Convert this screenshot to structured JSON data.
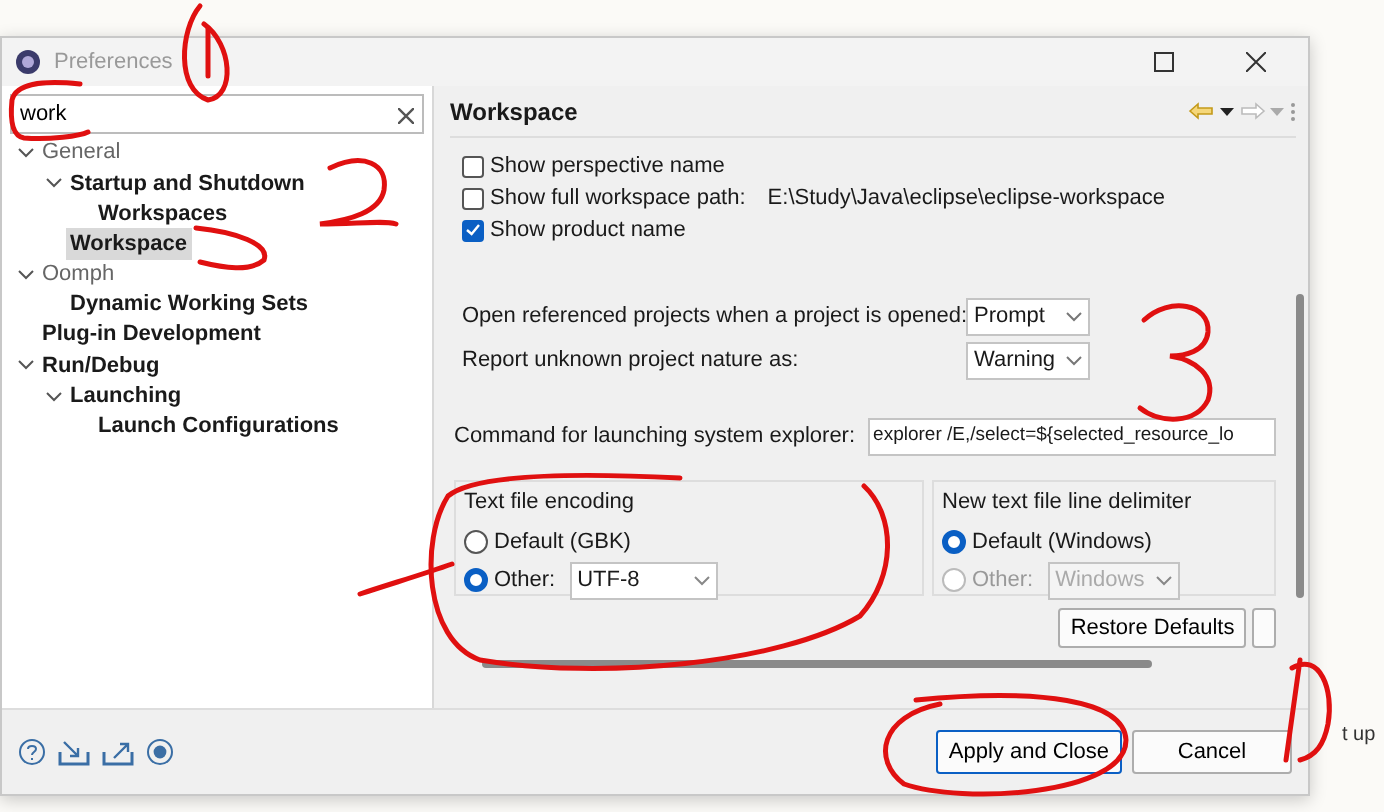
{
  "window": {
    "title": "Preferences"
  },
  "filter": {
    "value": "work"
  },
  "tree": [
    {
      "label": "General",
      "matched": false,
      "selected": false,
      "expanded": true,
      "children": [
        {
          "label": "Startup and Shutdown",
          "matched": true,
          "selected": false,
          "expanded": true,
          "children": [
            {
              "label": "Workspaces",
              "matched": true,
              "selected": false
            }
          ]
        },
        {
          "label": "Workspace",
          "matched": true,
          "selected": true
        }
      ]
    },
    {
      "label": "Oomph",
      "matched": false,
      "selected": false,
      "expanded": true,
      "children": [
        {
          "label": "Dynamic Working Sets",
          "matched": true,
          "selected": false
        }
      ]
    },
    {
      "label": "Plug-in Development",
      "matched": true,
      "selected": false
    },
    {
      "label": "Run/Debug",
      "matched": true,
      "selected": false,
      "expanded": true,
      "children": [
        {
          "label": "Launching",
          "matched": true,
          "selected": false,
          "expanded": true,
          "children": [
            {
              "label": "Launch Configurations",
              "matched": true,
              "selected": false
            }
          ]
        }
      ]
    }
  ],
  "page": {
    "title": "Workspace",
    "checkboxes": [
      {
        "label": "Show perspective name",
        "checked": false
      },
      {
        "label": "Show full workspace path:",
        "checked": false,
        "value": "E:\\Study\\Java\\eclipse\\eclipse-workspace"
      },
      {
        "label": "Show product name",
        "checked": true
      }
    ],
    "selects": [
      {
        "label": "Open referenced projects when a project is opened:",
        "value": "Prompt"
      },
      {
        "label": "Report unknown project nature as:",
        "value": "Warning"
      }
    ],
    "command": {
      "label": "Command for launching system explorer:",
      "value": "explorer /E,/select=${selected_resource_lo"
    },
    "groups": [
      {
        "title": "Text file encoding",
        "options": [
          {
            "label": "Default (GBK)",
            "selected": false
          },
          {
            "label": "Other:",
            "selected": true,
            "value": "UTF-8",
            "disabled": false
          }
        ]
      },
      {
        "title": "New text file line delimiter",
        "options": [
          {
            "label": "Default (Windows)",
            "selected": true
          },
          {
            "label": "Other:",
            "selected": false,
            "value": "Windows",
            "disabled": true
          }
        ]
      }
    ],
    "buttons": [
      "Restore Defaults"
    ]
  },
  "footer": {
    "buttons": [
      {
        "label": "Apply and Close",
        "default": true
      },
      {
        "label": "Cancel",
        "default": false
      }
    ]
  },
  "background": {
    "text": "t up"
  }
}
